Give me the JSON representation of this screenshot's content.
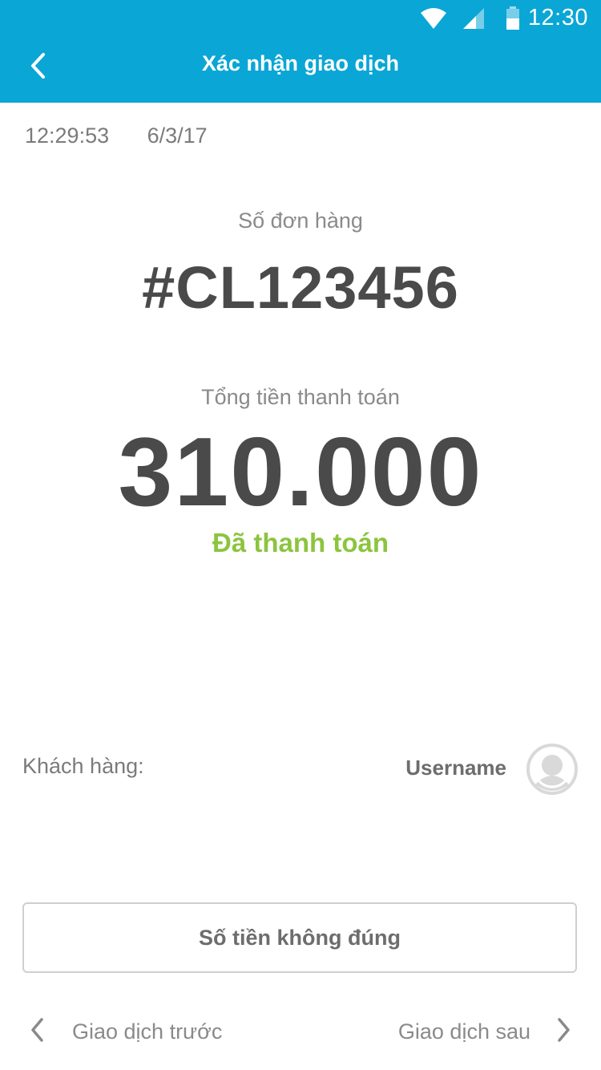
{
  "status_bar": {
    "time": "12:30",
    "icons": [
      "wifi-icon",
      "signal-icon",
      "battery-icon"
    ]
  },
  "app_bar": {
    "title": "Xác nhận giao dịch",
    "back_icon": "chevron-left-icon"
  },
  "transaction": {
    "time": "12:29:53",
    "date": "6/3/17",
    "order_label": "Số đơn hàng",
    "order_number": "#CL123456",
    "total_label": "Tổng tiền thanh toán",
    "total_amount": "310.000",
    "status": "Đã thanh toán"
  },
  "customer": {
    "label": "Khách hàng:",
    "name": "Username",
    "avatar_icon": "user-avatar-icon"
  },
  "actions": {
    "wrong_amount_label": "Số tiền không đúng"
  },
  "navigation": {
    "prev_label": "Giao dịch trước",
    "next_label": "Giao dịch sau"
  },
  "colors": {
    "header": "#0aa6d6",
    "paid": "#8cc43f",
    "primary_text": "#4a4a4a",
    "secondary_text": "#8a8a8a"
  }
}
